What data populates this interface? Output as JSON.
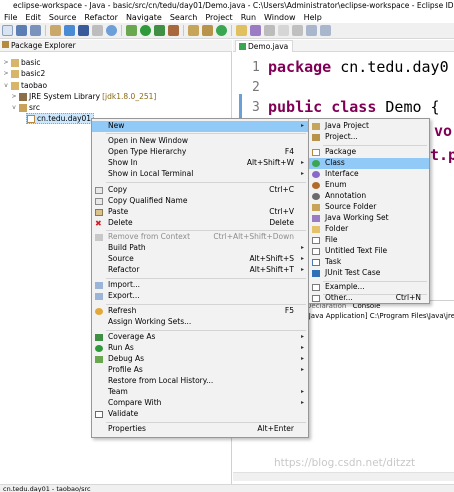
{
  "window": {
    "title": "eclipse-workspace - Java - basic/src/cn/tedu/day01/Demo.java - C:\\Users\\Administrator\\eclipse-workspace - Eclipse IDE"
  },
  "menubar": [
    "File",
    "Edit",
    "Source",
    "Refactor",
    "Navigate",
    "Search",
    "Project",
    "Run",
    "Window",
    "Help"
  ],
  "package_explorer": {
    "title": "Package Explorer",
    "tree": {
      "basic": "basic",
      "basic2": "basic2",
      "taobao": "taobao",
      "jre": "JRE System Library",
      "jre_version": "[jdk1.8.0_251]",
      "src": "src",
      "pkg": "cn.tedu.day01"
    }
  },
  "editor": {
    "tab": "Demo.java",
    "lines": [
      {
        "num": "1",
        "kw": "package",
        "rest": " cn.tedu.day0"
      },
      {
        "num": "2",
        "kw": "",
        "rest": ""
      },
      {
        "num": "3",
        "kw": "public class",
        "rest": " Demo {"
      }
    ],
    "partial_line4": "vo",
    "partial_line5": "t.p"
  },
  "console": {
    "tabs": "Declaration",
    "active_tab": "Console",
    "text": "[Java Application] C:\\Program Files\\Java\\jre"
  },
  "watermark": "https://blog.csdn.net/ditzzt",
  "statusbar": "cn.tedu.day01 - taobao/src",
  "context_menu": {
    "new": "New",
    "new_arrow": "▸",
    "open_new_window": "Open in New Window",
    "open_type_hierarchy": "Open Type Hierarchy",
    "open_type_hierarchy_acc": "F4",
    "show_in": "Show In",
    "show_in_acc": "Alt+Shift+W",
    "show_in_terminal": "Show in Local Terminal",
    "copy": "Copy",
    "copy_acc": "Ctrl+C",
    "copy_qualified": "Copy Qualified Name",
    "paste": "Paste",
    "paste_acc": "Ctrl+V",
    "delete": "Delete",
    "delete_acc": "Delete",
    "remove_ctx": "Remove from Context",
    "remove_ctx_acc": "Ctrl+Alt+Shift+Down",
    "build_path": "Build Path",
    "source": "Source",
    "source_acc": "Alt+Shift+S",
    "refactor": "Refactor",
    "refactor_acc": "Alt+Shift+T",
    "import": "Import...",
    "export": "Export...",
    "refresh": "Refresh",
    "refresh_acc": "F5",
    "assign_ws": "Assign Working Sets...",
    "coverage_as": "Coverage As",
    "run_as": "Run As",
    "debug_as": "Debug As",
    "profile_as": "Profile As",
    "restore_history": "Restore from Local History...",
    "team": "Team",
    "compare_with": "Compare With",
    "validate": "Validate",
    "properties": "Properties",
    "properties_acc": "Alt+Enter"
  },
  "submenu": {
    "java_project": "Java Project",
    "project": "Project...",
    "package": "Package",
    "class": "Class",
    "interface": "Interface",
    "enum": "Enum",
    "annotation": "Annotation",
    "source_folder": "Source Folder",
    "java_working_set": "Java Working Set",
    "folder": "Folder",
    "file": "File",
    "untitled_text_file": "Untitled Text File",
    "task": "Task",
    "junit_test_case": "JUnit Test Case",
    "example": "Example...",
    "other": "Other...",
    "other_acc": "Ctrl+N"
  },
  "colors": {
    "highlight": "#91c9f7",
    "keyword": "#7f0055",
    "menu_bg": "#f2f2f2"
  }
}
